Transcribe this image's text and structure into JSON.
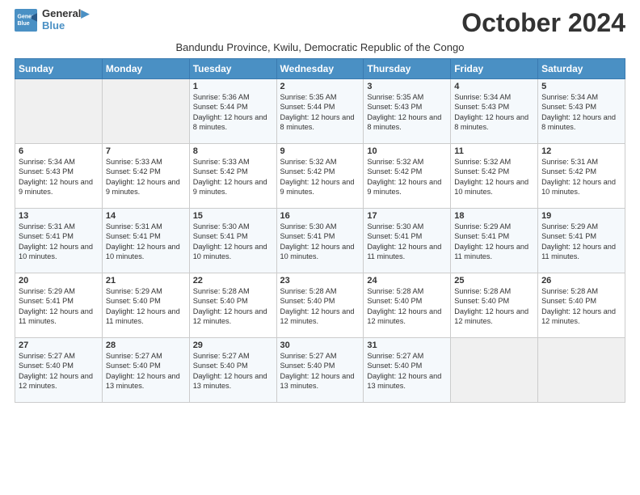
{
  "logo": {
    "line1": "General",
    "line2": "Blue"
  },
  "title": "October 2024",
  "subtitle": "Bandundu Province, Kwilu, Democratic Republic of the Congo",
  "days_of_week": [
    "Sunday",
    "Monday",
    "Tuesday",
    "Wednesday",
    "Thursday",
    "Friday",
    "Saturday"
  ],
  "weeks": [
    [
      {
        "day": "",
        "sunrise": "",
        "sunset": "",
        "daylight": ""
      },
      {
        "day": "",
        "sunrise": "",
        "sunset": "",
        "daylight": ""
      },
      {
        "day": "1",
        "sunrise": "Sunrise: 5:36 AM",
        "sunset": "Sunset: 5:44 PM",
        "daylight": "Daylight: 12 hours and 8 minutes."
      },
      {
        "day": "2",
        "sunrise": "Sunrise: 5:35 AM",
        "sunset": "Sunset: 5:44 PM",
        "daylight": "Daylight: 12 hours and 8 minutes."
      },
      {
        "day": "3",
        "sunrise": "Sunrise: 5:35 AM",
        "sunset": "Sunset: 5:43 PM",
        "daylight": "Daylight: 12 hours and 8 minutes."
      },
      {
        "day": "4",
        "sunrise": "Sunrise: 5:34 AM",
        "sunset": "Sunset: 5:43 PM",
        "daylight": "Daylight: 12 hours and 8 minutes."
      },
      {
        "day": "5",
        "sunrise": "Sunrise: 5:34 AM",
        "sunset": "Sunset: 5:43 PM",
        "daylight": "Daylight: 12 hours and 8 minutes."
      }
    ],
    [
      {
        "day": "6",
        "sunrise": "Sunrise: 5:34 AM",
        "sunset": "Sunset: 5:43 PM",
        "daylight": "Daylight: 12 hours and 9 minutes."
      },
      {
        "day": "7",
        "sunrise": "Sunrise: 5:33 AM",
        "sunset": "Sunset: 5:42 PM",
        "daylight": "Daylight: 12 hours and 9 minutes."
      },
      {
        "day": "8",
        "sunrise": "Sunrise: 5:33 AM",
        "sunset": "Sunset: 5:42 PM",
        "daylight": "Daylight: 12 hours and 9 minutes."
      },
      {
        "day": "9",
        "sunrise": "Sunrise: 5:32 AM",
        "sunset": "Sunset: 5:42 PM",
        "daylight": "Daylight: 12 hours and 9 minutes."
      },
      {
        "day": "10",
        "sunrise": "Sunrise: 5:32 AM",
        "sunset": "Sunset: 5:42 PM",
        "daylight": "Daylight: 12 hours and 9 minutes."
      },
      {
        "day": "11",
        "sunrise": "Sunrise: 5:32 AM",
        "sunset": "Sunset: 5:42 PM",
        "daylight": "Daylight: 12 hours and 10 minutes."
      },
      {
        "day": "12",
        "sunrise": "Sunrise: 5:31 AM",
        "sunset": "Sunset: 5:42 PM",
        "daylight": "Daylight: 12 hours and 10 minutes."
      }
    ],
    [
      {
        "day": "13",
        "sunrise": "Sunrise: 5:31 AM",
        "sunset": "Sunset: 5:41 PM",
        "daylight": "Daylight: 12 hours and 10 minutes."
      },
      {
        "day": "14",
        "sunrise": "Sunrise: 5:31 AM",
        "sunset": "Sunset: 5:41 PM",
        "daylight": "Daylight: 12 hours and 10 minutes."
      },
      {
        "day": "15",
        "sunrise": "Sunrise: 5:30 AM",
        "sunset": "Sunset: 5:41 PM",
        "daylight": "Daylight: 12 hours and 10 minutes."
      },
      {
        "day": "16",
        "sunrise": "Sunrise: 5:30 AM",
        "sunset": "Sunset: 5:41 PM",
        "daylight": "Daylight: 12 hours and 10 minutes."
      },
      {
        "day": "17",
        "sunrise": "Sunrise: 5:30 AM",
        "sunset": "Sunset: 5:41 PM",
        "daylight": "Daylight: 12 hours and 11 minutes."
      },
      {
        "day": "18",
        "sunrise": "Sunrise: 5:29 AM",
        "sunset": "Sunset: 5:41 PM",
        "daylight": "Daylight: 12 hours and 11 minutes."
      },
      {
        "day": "19",
        "sunrise": "Sunrise: 5:29 AM",
        "sunset": "Sunset: 5:41 PM",
        "daylight": "Daylight: 12 hours and 11 minutes."
      }
    ],
    [
      {
        "day": "20",
        "sunrise": "Sunrise: 5:29 AM",
        "sunset": "Sunset: 5:41 PM",
        "daylight": "Daylight: 12 hours and 11 minutes."
      },
      {
        "day": "21",
        "sunrise": "Sunrise: 5:29 AM",
        "sunset": "Sunset: 5:40 PM",
        "daylight": "Daylight: 12 hours and 11 minutes."
      },
      {
        "day": "22",
        "sunrise": "Sunrise: 5:28 AM",
        "sunset": "Sunset: 5:40 PM",
        "daylight": "Daylight: 12 hours and 12 minutes."
      },
      {
        "day": "23",
        "sunrise": "Sunrise: 5:28 AM",
        "sunset": "Sunset: 5:40 PM",
        "daylight": "Daylight: 12 hours and 12 minutes."
      },
      {
        "day": "24",
        "sunrise": "Sunrise: 5:28 AM",
        "sunset": "Sunset: 5:40 PM",
        "daylight": "Daylight: 12 hours and 12 minutes."
      },
      {
        "day": "25",
        "sunrise": "Sunrise: 5:28 AM",
        "sunset": "Sunset: 5:40 PM",
        "daylight": "Daylight: 12 hours and 12 minutes."
      },
      {
        "day": "26",
        "sunrise": "Sunrise: 5:28 AM",
        "sunset": "Sunset: 5:40 PM",
        "daylight": "Daylight: 12 hours and 12 minutes."
      }
    ],
    [
      {
        "day": "27",
        "sunrise": "Sunrise: 5:27 AM",
        "sunset": "Sunset: 5:40 PM",
        "daylight": "Daylight: 12 hours and 12 minutes."
      },
      {
        "day": "28",
        "sunrise": "Sunrise: 5:27 AM",
        "sunset": "Sunset: 5:40 PM",
        "daylight": "Daylight: 12 hours and 13 minutes."
      },
      {
        "day": "29",
        "sunrise": "Sunrise: 5:27 AM",
        "sunset": "Sunset: 5:40 PM",
        "daylight": "Daylight: 12 hours and 13 minutes."
      },
      {
        "day": "30",
        "sunrise": "Sunrise: 5:27 AM",
        "sunset": "Sunset: 5:40 PM",
        "daylight": "Daylight: 12 hours and 13 minutes."
      },
      {
        "day": "31",
        "sunrise": "Sunrise: 5:27 AM",
        "sunset": "Sunset: 5:40 PM",
        "daylight": "Daylight: 12 hours and 13 minutes."
      },
      {
        "day": "",
        "sunrise": "",
        "sunset": "",
        "daylight": ""
      },
      {
        "day": "",
        "sunrise": "",
        "sunset": "",
        "daylight": ""
      }
    ]
  ]
}
